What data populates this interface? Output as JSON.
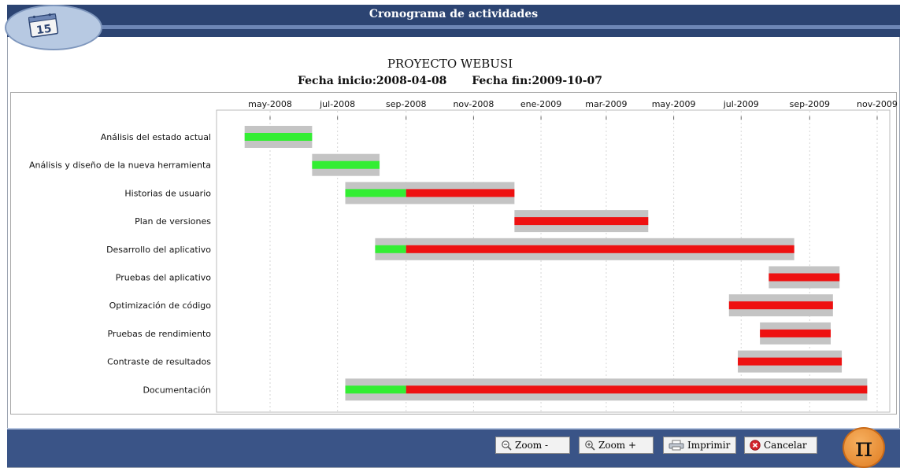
{
  "window": {
    "title": "Cronograma de actividades"
  },
  "header": {
    "project": "PROYECTO WEBUSI",
    "start_label": "Fecha inicio:",
    "start_value": "2008-04-08",
    "end_label": "Fecha fin:",
    "end_value": "2009-10-07"
  },
  "calendar_icon": {
    "day": "15"
  },
  "chart_data": {
    "type": "gantt",
    "time_ticks": [
      "may-2008",
      "jul-2008",
      "sep-2008",
      "nov-2008",
      "ene-2009",
      "mar-2009",
      "may-2009",
      "jul-2009",
      "sep-2009",
      "nov-2009"
    ],
    "tick_dates": [
      "2008-05-01",
      "2008-07-01",
      "2008-09-01",
      "2008-11-01",
      "2009-01-01",
      "2009-03-01",
      "2009-05-01",
      "2009-07-01",
      "2009-09-01",
      "2009-11-01"
    ],
    "colors": {
      "done": "#33ee33",
      "pending": "#ee1111",
      "planned": "#c4c4c4"
    },
    "tasks": [
      {
        "name": "Análisis del estado actual",
        "start": "2008-04-08",
        "end": "2008-06-08",
        "progress_end": "2008-06-08"
      },
      {
        "name": "Análisis y diseño de la nueva herramienta",
        "start": "2008-06-08",
        "end": "2008-08-08",
        "progress_end": "2008-08-08"
      },
      {
        "name": "Historias de usuario",
        "start": "2008-07-08",
        "end": "2008-12-08",
        "progress_end": "2008-09-01"
      },
      {
        "name": "Plan de versiones",
        "start": "2008-12-08",
        "end": "2009-04-08",
        "progress_end": "2008-12-08"
      },
      {
        "name": "Desarrollo del aplicativo",
        "start": "2008-08-04",
        "end": "2009-08-18",
        "progress_end": "2008-09-01"
      },
      {
        "name": "Pruebas del aplicativo",
        "start": "2009-07-26",
        "end": "2009-09-28",
        "progress_end": "2009-07-26"
      },
      {
        "name": "Optimización de código",
        "start": "2009-06-20",
        "end": "2009-09-22",
        "progress_end": "2009-06-20"
      },
      {
        "name": "Pruebas de rendimiento",
        "start": "2009-07-18",
        "end": "2009-09-20",
        "progress_end": "2009-07-18"
      },
      {
        "name": "Contraste de resultados",
        "start": "2009-06-28",
        "end": "2009-09-30",
        "progress_end": "2009-06-28"
      },
      {
        "name": "Documentación",
        "start": "2008-07-08",
        "end": "2009-10-23",
        "progress_end": "2008-09-01"
      }
    ]
  },
  "buttons": {
    "zoom_out": "Zoom -",
    "zoom_in": "Zoom +",
    "print": "Imprimir",
    "cancel": "Cancelar"
  },
  "logo": {
    "symbol": "π"
  }
}
